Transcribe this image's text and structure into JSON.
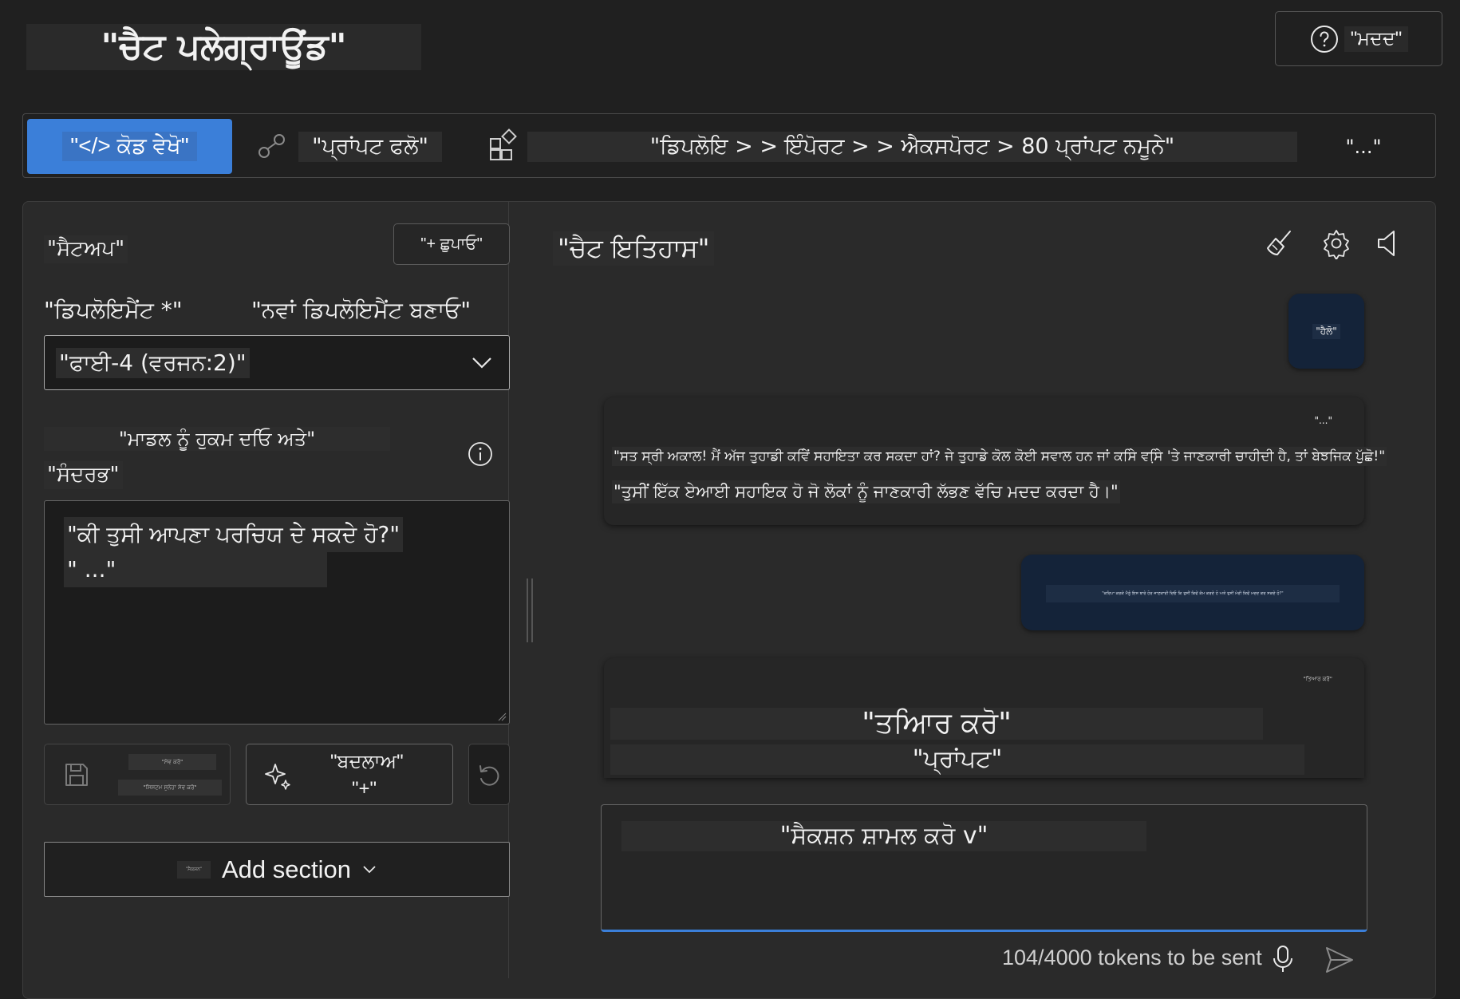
{
  "header": {
    "title": "\"ਚੈਟ ਪਲੇਗ੍ਰਾਊਂਡ\"",
    "help_label": "\"ਮਦਦ\""
  },
  "toolbar": {
    "view_code_label": "\"</> ਕੋਡ ਵੇਖੋ\"",
    "prompt_flow_label": "\"ਪ੍ਰਾਂਪਟ ਫਲੋ\"",
    "deploy_breadcrumb": "\"ਡਿਪਲੋਇ > > ਇੰਪੋਰਟ > > ਐਕਸਪੋਰਟ > 80 ਪ੍ਰਾਂਪਟ ਨਮੂਨੇ\"",
    "more_label": "\"...\""
  },
  "setup": {
    "title": "\"ਸੈਟਅਪ\"",
    "hide_label": "\"+ ਛੁਪਾਓ\"",
    "deployment_label": "\"ਡਿਪਲੋਇਮੈਂਟ *\"",
    "new_deployment_label": "\"ਨਵਾਂ ਡਿਪਲੋਇਮੈਂਟ ਬਣਾਓ\"",
    "deployment_value": "\"ਫਾਈ-4 (ਵਰਜਨ:2)\"",
    "instructions_label": "\"ਮਾਡਲ ਨੂੰ ਹੁਕਮ ਦਓਿ ਅਤੇ\"",
    "context_label": "\"ਸੰਦਰਭ\"",
    "system_message_line1": "\"ਕੀ ਤੁਸੀ ਆਪਣਾ ਪਰਚਿਯ ਦੇ ਸਕਦੇ ਹੋ?\"",
    "system_message_line2": "\" ...\"",
    "save_text_1": "\"ਸੇਵ ਕਰੋ\"",
    "save_text_2": "\"ਸਿਸਟਮ ਸੁਨੇਹਾ ਸੇਵ ਕਰੋ\"",
    "change_label_1": "\"ਬਦਲਾਅ\"",
    "change_label_2": "\"+\"",
    "add_section_label": "Add section",
    "add_section_prefix": "\"ਸੈਕਸ਼ਨ\""
  },
  "chat": {
    "title": "\"ਚੈਟ ਇਤਿਹਾਸ\"",
    "user_message_1": "\"ਹੈਲੋ\"",
    "assistant_more": "\"...\"",
    "assistant_message_1": "\"ਸਤ ਸ੍ਰੀ ਅਕਾਲ! ਮੈਂ ਅੱਜ ਤੁਹਾਡੀ ਕਵਿੇਂ ਸਹਾਇਤਾ ਕਰ ਸਕਦਾ ਹਾਂ? ਜੇ ਤੁਹਾਡੇ ਕੋਲ ਕੋਈ ਸਵਾਲ ਹਨ ਜਾਂ ਕਸਿੇ ਵਸਿ਼ੇ 'ਤੇ ਜਾਣਕਾਰੀ ਚਾਹੀਦੀ ਹੈ, ਤਾਂ ਬੇਝਜਿਕ ਪੁੱਛੋ!\"",
    "assistant_message_2": "\"ਤੁਸੀਂ ਇੱਕ ਏਆਈ ਸਹਾਇਕ ਹੋ ਜੋ ਲੋਕਾਂ ਨੂੰ ਜਾਣਕਾਰੀ ਲੱਭਣ ਵੱਚਿ ਮਦਦ ਕਰਦਾ ਹੈ।\"",
    "user_message_2": "\"ਕਰਿਪਾ ਕਰਕੇ ਮੈਨੂੰ ਇਸ ਬਾਰੇ ਹੋਰ ਜਾਣਕਾਰੀ ਦਿਓ ਕਿ ਤੁਸੀਂ ਕਿਵੇਂ ਕੰਮ ਕਰਦੇ ਹੋ ਅਤੇ ਤੁਸੀਂ ਮੇਰੀ ਕਿਵੇਂ ਮਦਦ ਕਰ ਸਕਦੇ ਹੋ?\"",
    "assistant_small": "\"ਤਿਆਰ ਕਰੋ\"",
    "assistant_prepare": "\"ਤਆਿਰ ਕਰੋ\"",
    "assistant_prompt": "\"ਪ੍ਰਾਂਪਟ\"",
    "input_placeholder": "\"ਸੈਕਸ਼ਨ ਸ਼ਾਮਲ ਕਰੋ v\"",
    "token_count": "104/4000 tokens to be sent"
  },
  "icons": {
    "help": "help-circle-icon",
    "prompt_flow": "prompt-flow-icon",
    "deploy": "grid-add-icon",
    "chevron": "chevron-down-icon",
    "info": "info-icon",
    "save": "save-icon",
    "sparkle": "sparkle-icon",
    "reset": "reset-icon",
    "clear": "broom-icon",
    "settings": "gear-icon",
    "speaker": "speaker-icon",
    "mic": "microphone-icon",
    "send": "send-icon"
  },
  "colors": {
    "background": "#202020",
    "panel": "#2a2a2a",
    "accent": "#3b7fd9",
    "user_bubble": "#142339"
  }
}
